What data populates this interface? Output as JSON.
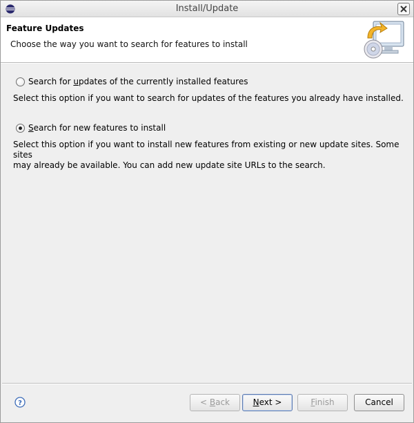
{
  "window": {
    "title": "Install/Update"
  },
  "banner": {
    "title": "Feature Updates",
    "description": "Choose the way you want to search for features to install"
  },
  "options": [
    {
      "label_before": "Search for ",
      "label_mnemonic": "u",
      "label_after": "pdates of the currently installed features",
      "description": "Select this option if you want to search for updates of the features you already have installed.",
      "selected": false
    },
    {
      "label_before": "",
      "label_mnemonic": "S",
      "label_after": "earch for new features to install",
      "description_line1": "Select this option if you want to install new features from existing or new update sites. Some sites",
      "description_line2": "may already be available. You can add new update site URLs to the search.",
      "selected": true
    }
  ],
  "buttons": {
    "back_mnemonic": "< ",
    "back_key": "B",
    "back_rest": "ack",
    "next_key": "N",
    "next_rest": "ext >",
    "finish_key": "F",
    "finish_rest": "inish",
    "cancel": "Cancel"
  },
  "icons": {
    "app": "eclipse-icon",
    "close": "close-icon",
    "help": "help-icon",
    "banner": "install-update-wizard-graphic"
  }
}
